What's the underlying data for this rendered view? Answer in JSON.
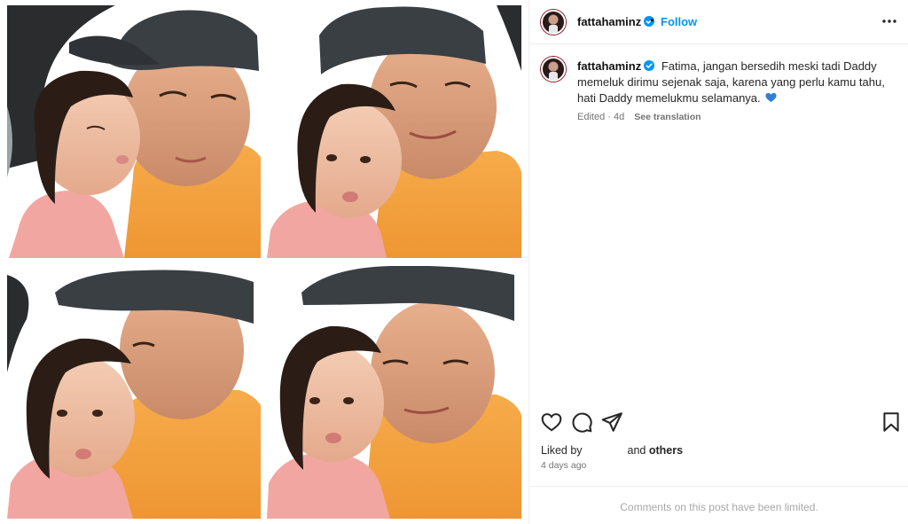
{
  "post": {
    "username": "fattahaminz",
    "verified": true,
    "follow_label": "Follow",
    "header_separator": "•",
    "caption": "Fatima, jangan bersedih meski tadi Daddy memeluk dirimu sejenak saja, karena yang perlu kamu tahu, hati Daddy memelukmu selamanya.",
    "caption_emoji": "blue-heart-icon",
    "edited_label": "Edited · 4d",
    "see_translation_label": "See translation",
    "liked_by_label": "Liked by",
    "and_label": "and",
    "others_label": "others",
    "timestamp": "4 days ago",
    "comments_limited": "Comments on this post have been limited."
  },
  "icons": {
    "more": "more-options-icon",
    "like": "heart-icon",
    "comment": "comment-icon",
    "share": "share-icon",
    "save": "bookmark-icon",
    "verified": "verified-badge-icon"
  },
  "photos": [
    {
      "name": "photo-kiss-cheek"
    },
    {
      "name": "photo-cheek-to-cheek"
    },
    {
      "name": "photo-kiss-forehead"
    },
    {
      "name": "photo-smiling-selfie"
    }
  ],
  "colors": {
    "accent_blue": "#0095f6",
    "verified_blue": "#0095f6",
    "cap_color": "#3a3f44",
    "shirt_orange": "#f4a23e",
    "girl_dress_pink": "#f2a6a1"
  }
}
